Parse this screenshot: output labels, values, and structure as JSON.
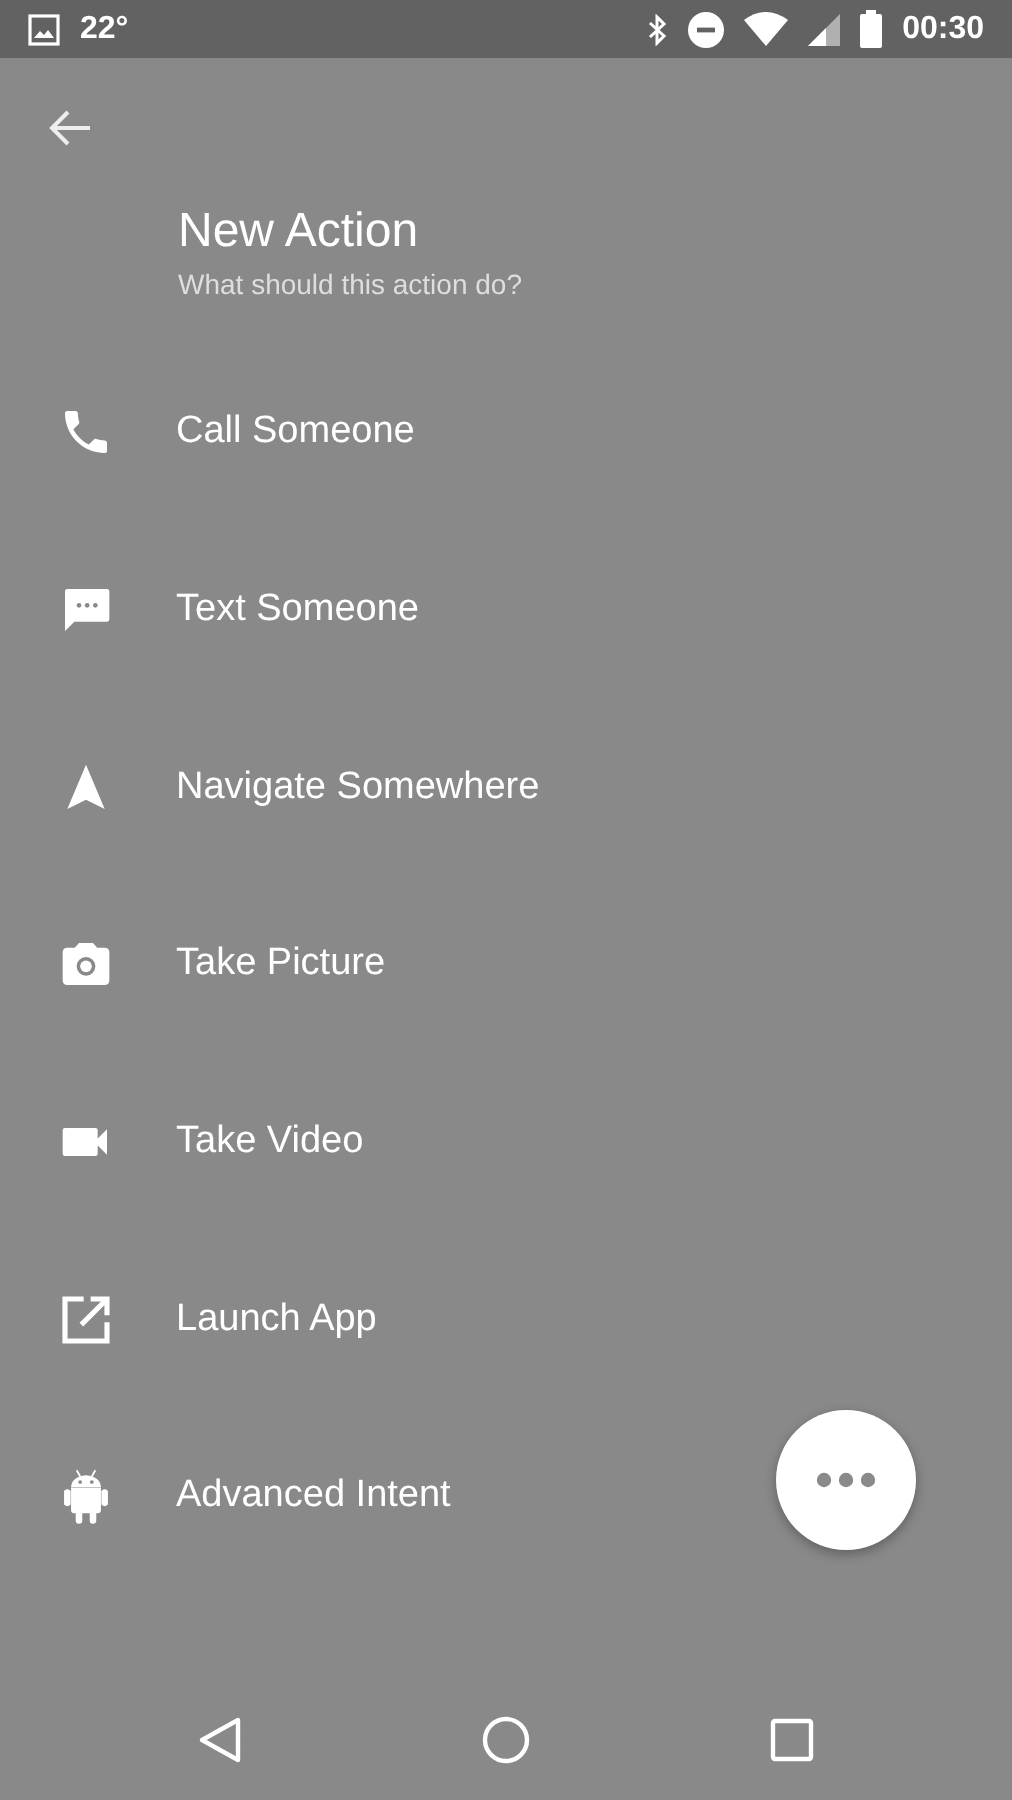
{
  "status_bar": {
    "temperature": "22°",
    "time": "00:30"
  },
  "header": {
    "title": "New Action",
    "subtitle": "What should this action do?"
  },
  "actions": [
    {
      "kind": "phone",
      "label": "Call Someone"
    },
    {
      "kind": "message",
      "label": "Text Someone"
    },
    {
      "kind": "navigation",
      "label": "Navigate Somewhere"
    },
    {
      "kind": "camera",
      "label": "Take Picture"
    },
    {
      "kind": "video",
      "label": "Take Video"
    },
    {
      "kind": "launch",
      "label": "Launch App"
    },
    {
      "kind": "android",
      "label": "Advanced Intent"
    }
  ]
}
